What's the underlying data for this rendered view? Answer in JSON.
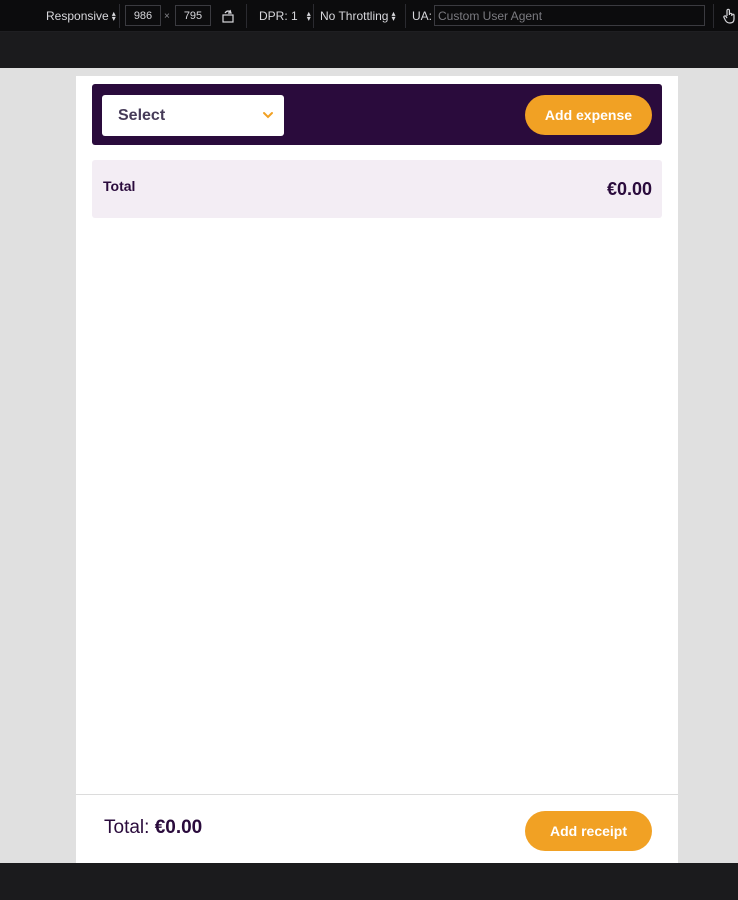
{
  "devtools": {
    "device": "Responsive",
    "width": "986",
    "times": "×",
    "height": "795",
    "dpr": "DPR: 1",
    "throttling": "No Throttling",
    "ua_label": "UA:",
    "ua_placeholder": "Custom User Agent"
  },
  "header": {
    "select_label": "Select",
    "add_expense": "Add expense"
  },
  "summary": {
    "total_label": "Total",
    "total_value": "€0.00"
  },
  "footer": {
    "total_label": "Total:",
    "total_value": "€0.00",
    "add_receipt": "Add receipt"
  },
  "colors": {
    "brand_dark": "#2a0b3c",
    "accent": "#f1a124",
    "card_bg": "#f3edf4"
  },
  "icons": [
    "chevron-down-icon",
    "rotate-icon",
    "touch-icon",
    "updown-icon"
  ]
}
